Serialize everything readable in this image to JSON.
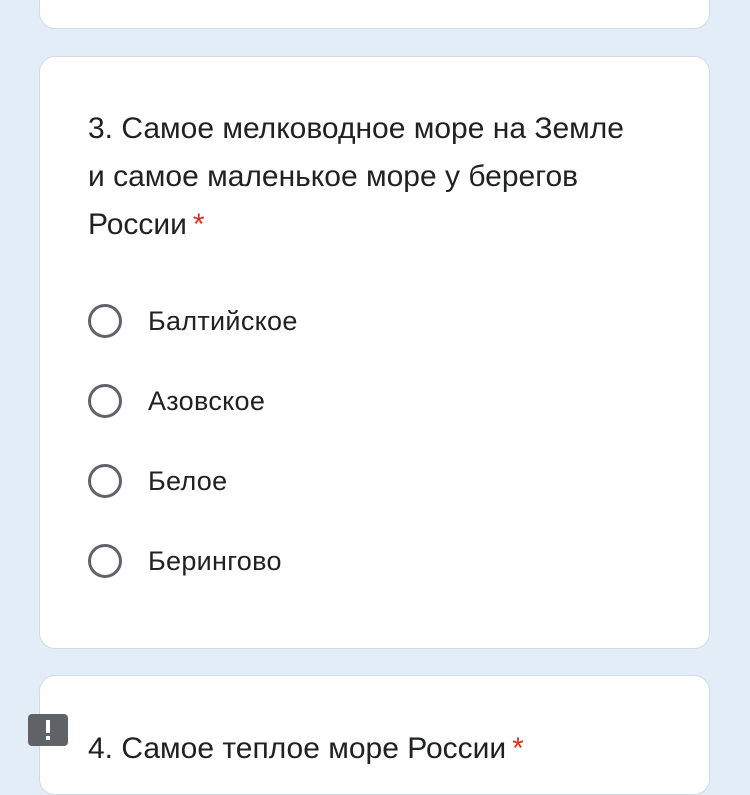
{
  "question3": {
    "title": "3. Самое мелководное море на Земле и самое маленькое море у берегов России",
    "required_marker": "*",
    "options": [
      {
        "label": "Балтийское"
      },
      {
        "label": "Азовское"
      },
      {
        "label": "Белое"
      },
      {
        "label": "Берингово"
      }
    ]
  },
  "question4": {
    "title": "4. Самое теплое море России",
    "required_marker": "*"
  },
  "icons": {
    "report": "exclamation-icon"
  },
  "colors": {
    "background": "#e3edf8",
    "card": "#ffffff",
    "required": "#d93025",
    "radio_border": "#5f6368"
  }
}
